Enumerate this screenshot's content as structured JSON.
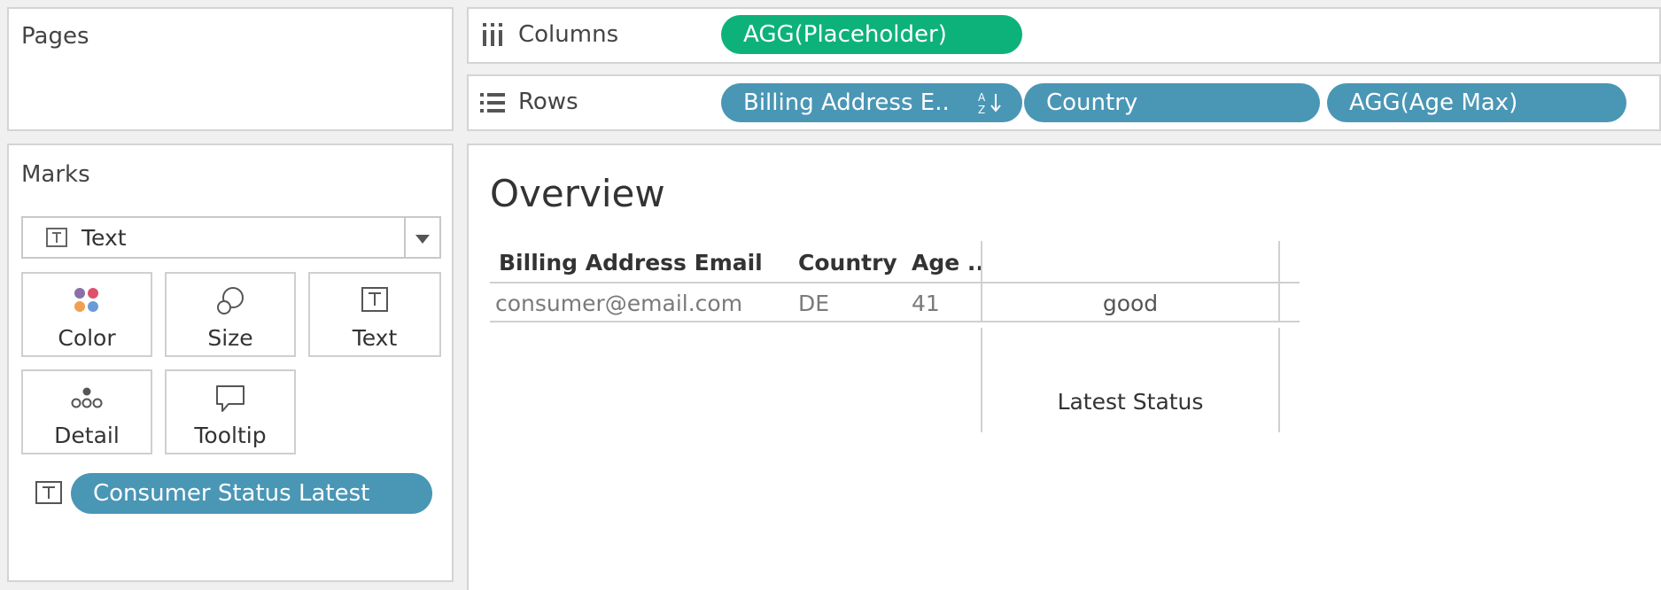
{
  "pages": {
    "title": "Pages"
  },
  "columns": {
    "label": "Columns",
    "pills": [
      "AGG(Placeholder)"
    ]
  },
  "rows": {
    "label": "Rows",
    "pills": [
      "Billing Address E..",
      "Country",
      "AGG(Age Max)"
    ]
  },
  "marks": {
    "title": "Marks",
    "mark_type": "Text",
    "buttons": [
      "Color",
      "Size",
      "Text",
      "Detail",
      "Tooltip"
    ],
    "text_pill": "Consumer Status Latest"
  },
  "view": {
    "title": "Overview",
    "headers": [
      "Billing Address Email",
      "Country",
      "Age .."
    ],
    "row": {
      "email": "consumer@email.com",
      "country": "DE",
      "age": "41",
      "status": "good"
    },
    "column_label": "Latest Status"
  },
  "colors": {
    "green_pill": "#0db27a",
    "blue_pill": "#4a96b5"
  },
  "icons": [
    "columns-icon",
    "rows-icon",
    "sort-az-icon",
    "text-mark-icon",
    "dropdown-arrow-icon",
    "color-icon",
    "size-icon",
    "detail-icon",
    "tooltip-icon"
  ]
}
